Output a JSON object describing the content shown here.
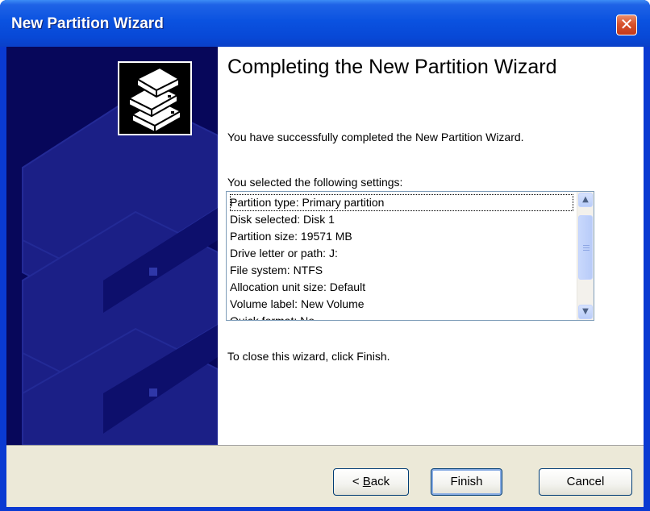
{
  "window": {
    "title": "New Partition Wizard",
    "close_glyph": "✕"
  },
  "content": {
    "heading": "Completing the New Partition Wizard",
    "success_message": "You have successfully completed the New Partition Wizard.",
    "settings_label": "You selected the following settings:",
    "settings": [
      "Partition type: Primary partition",
      "Disk selected: Disk 1",
      "Partition size: 19571 MB",
      "Drive letter or path: J:",
      "File system: NTFS",
      "Allocation unit size: Default",
      "Volume label: New Volume",
      "Quick format: No"
    ],
    "close_instruction": "To close this wizard, click Finish."
  },
  "scrollbar": {
    "up_glyph": "▲",
    "down_glyph": "▼"
  },
  "buttons": {
    "back_prefix": "< ",
    "back_underlined": "B",
    "back_rest": "ack",
    "finish": "Finish",
    "cancel": "Cancel"
  },
  "icons": {
    "logo": "stacked-disks-icon",
    "close": "close-icon"
  },
  "colors": {
    "titlebar": "#0a52e0",
    "side_panel": "#07075a",
    "footer": "#ece9d8",
    "close_button": "#d8532c"
  }
}
